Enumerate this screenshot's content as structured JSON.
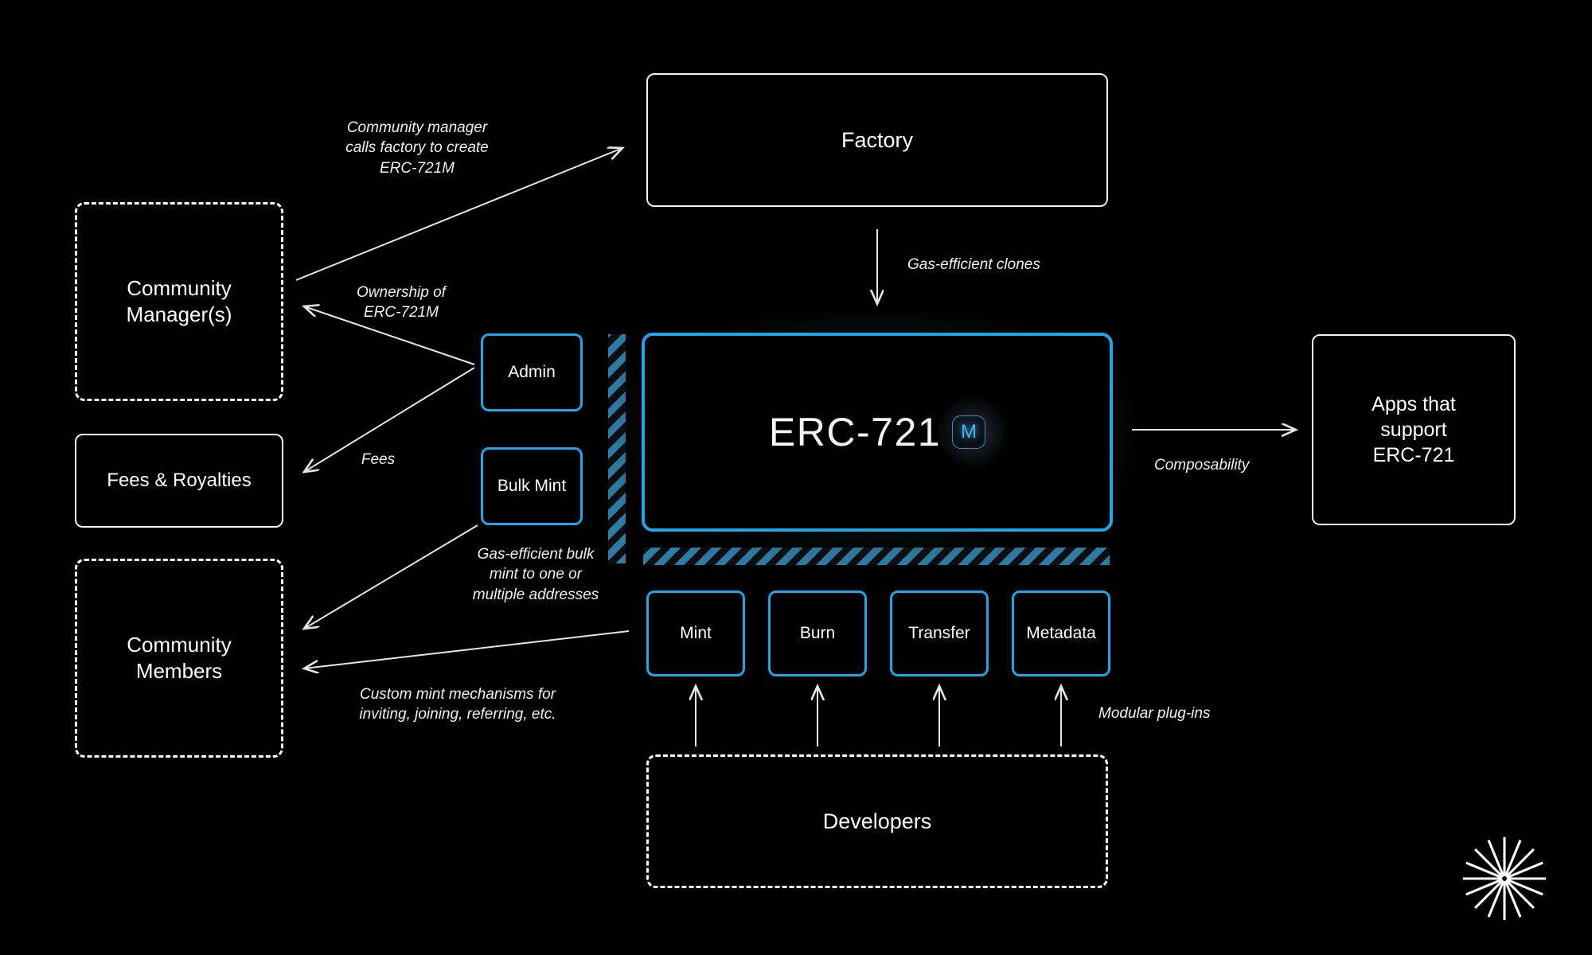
{
  "diagram": {
    "title": "ERC-721M architecture diagram",
    "background_color": "#000000",
    "accent_color": "#1ea7e8",
    "hatch_color": "#2e7ba3",
    "text_color": "#ffffff"
  },
  "nodes": {
    "factory": "Factory",
    "apps": "Apps that\nsupport\nERC-721",
    "community_manager": "Community\nManager(s)",
    "fees_royalties": "Fees & Royalties",
    "community_members": "Community\nMembers",
    "developers": "Developers",
    "admin": "Admin",
    "bulk_mint": "Bulk Mint",
    "erc_title": "ERC-721",
    "erc_badge": "M"
  },
  "plugins": [
    {
      "label": "Mint"
    },
    {
      "label": "Burn"
    },
    {
      "label": "Transfer"
    },
    {
      "label": "Metadata"
    }
  ],
  "labels": {
    "cm_calls_factory": "Community manager\ncalls factory to create\nERC-721M",
    "ownership": "Ownership of\nERC-721M",
    "fees": "Fees",
    "bulk_mint_desc": "Gas-efficient bulk\nmint to one or\nmultiple addresses",
    "custom_mint_desc": "Custom mint mechanisms for\ninviting, joining, referring, etc.",
    "gas_efficient_clones": "Gas-efficient clones",
    "composability": "Composability",
    "modular_plugins": "Modular plug-ins"
  },
  "logo": {
    "name": "starburst-logo",
    "ray_count": 16
  }
}
